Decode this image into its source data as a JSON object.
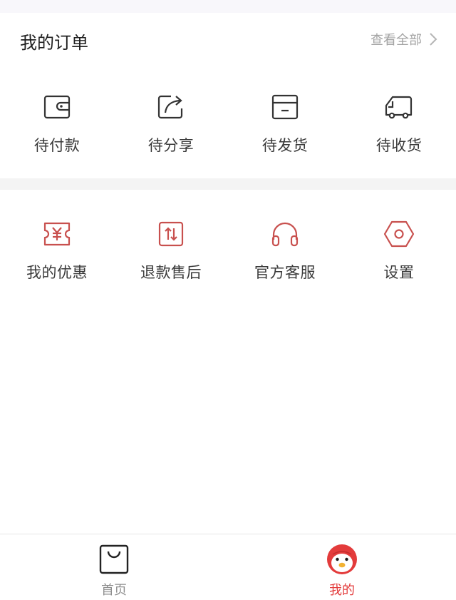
{
  "orders": {
    "title": "我的订单",
    "view_all_label": "查看全部"
  },
  "order_items": [
    {
      "label": "待付款",
      "icon": "wallet-icon"
    },
    {
      "label": "待分享",
      "icon": "share-icon"
    },
    {
      "label": "待发货",
      "icon": "box-icon"
    },
    {
      "label": "待收货",
      "icon": "truck-icon"
    }
  ],
  "service_items": [
    {
      "label": "我的优惠",
      "icon": "coupon-icon"
    },
    {
      "label": "退款售后",
      "icon": "refund-icon"
    },
    {
      "label": "官方客服",
      "icon": "headphones-icon"
    },
    {
      "label": "设置",
      "icon": "settings-icon"
    }
  ],
  "tabbar": {
    "home_label": "首页",
    "mine_label": "我的"
  },
  "colors": {
    "accent": "#e33b3b",
    "icon_dark": "#333333",
    "icon_red": "#c8504e",
    "muted": "#a3a3a3"
  }
}
